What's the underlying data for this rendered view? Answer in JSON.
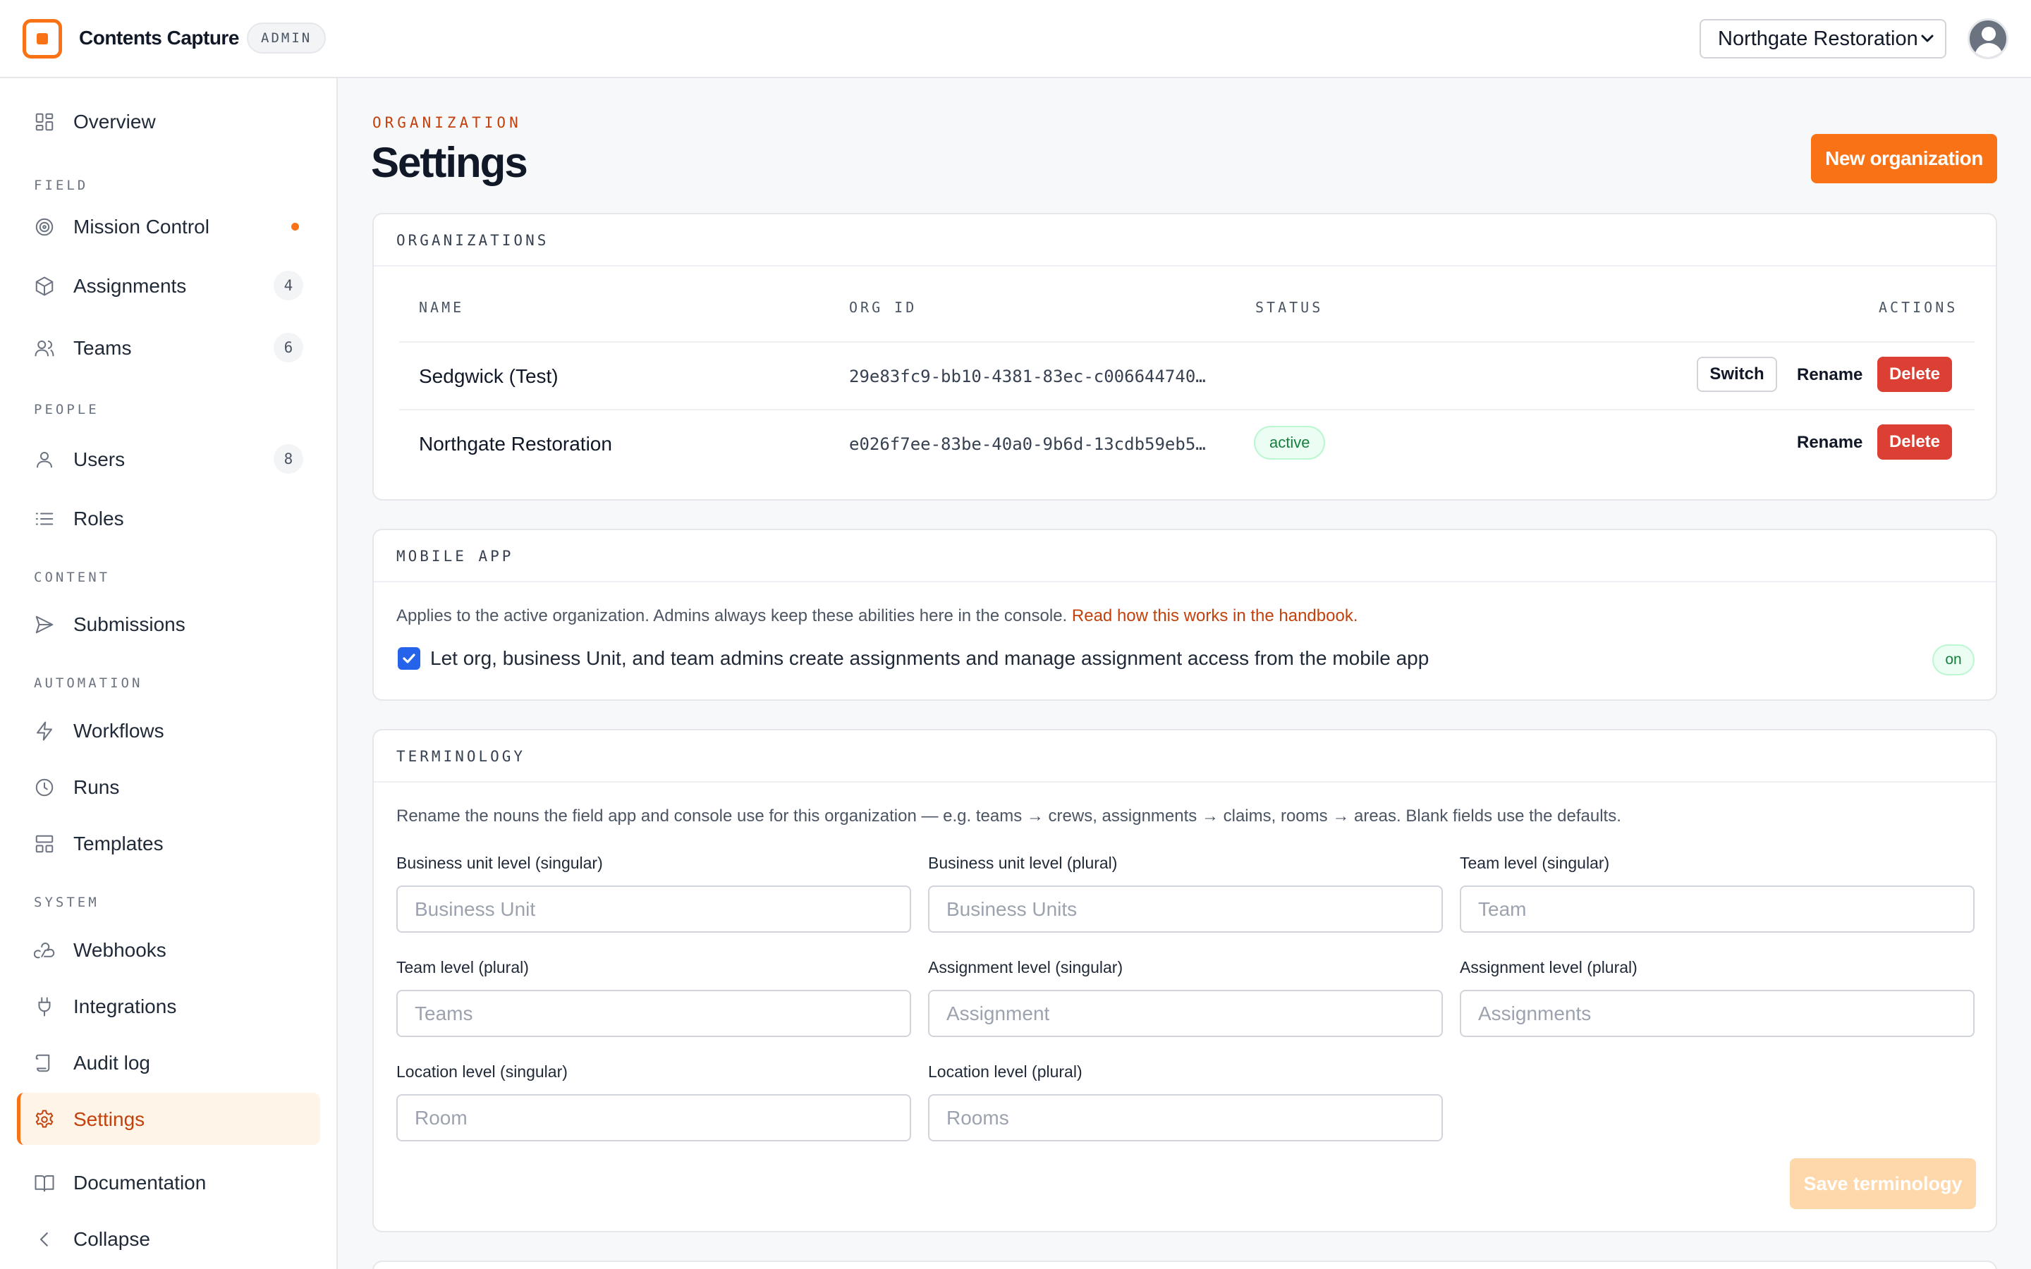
{
  "header": {
    "app_name": "Contents Capture",
    "role_badge": "ADMIN",
    "org_selector_value": "Northgate Restoration",
    "org_options": [
      "Northgate Restoration",
      "Sedgwick (Test)"
    ]
  },
  "sidebar": {
    "overview": "Overview",
    "sections": {
      "field": "FIELD",
      "people": "PEOPLE",
      "content": "CONTENT",
      "automation": "AUTOMATION",
      "system": "SYSTEM"
    },
    "items": {
      "mission_control": "Mission Control",
      "assignments": "Assignments",
      "assignments_count": "4",
      "teams": "Teams",
      "teams_count": "6",
      "users": "Users",
      "users_count": "8",
      "roles": "Roles",
      "submissions": "Submissions",
      "workflows": "Workflows",
      "runs": "Runs",
      "templates": "Templates",
      "webhooks": "Webhooks",
      "integrations": "Integrations",
      "audit_log": "Audit log",
      "settings": "Settings",
      "documentation": "Documentation",
      "collapse": "Collapse"
    }
  },
  "page": {
    "eyebrow": "ORGANIZATION",
    "title": "Settings",
    "new_org_button": "New organization"
  },
  "organizations": {
    "heading": "ORGANIZATIONS",
    "columns": {
      "name": "NAME",
      "org_id": "ORG ID",
      "status": "STATUS",
      "actions": "ACTIONS"
    },
    "rows": [
      {
        "name": "Sedgwick (Test)",
        "org_id": "29e83fc9-bb10-4381-83ec-c006644740…",
        "status": "",
        "switch": "Switch",
        "rename": "Rename",
        "delete": "Delete"
      },
      {
        "name": "Northgate Restoration",
        "org_id": "e026f7ee-83be-40a0-9b6d-13cdb59eb5…",
        "status": "active",
        "rename": "Rename",
        "delete": "Delete"
      }
    ]
  },
  "mobile_app": {
    "heading": "MOBILE APP",
    "description": "Applies to the active organization. Admins always keep these abilities here in the console.",
    "link": "Read how this works in the handbook.",
    "checkbox_label": "Let org, business Unit, and team admins create assignments and manage assignment access from the mobile app",
    "checked": true,
    "state_badge": "on"
  },
  "terminology": {
    "heading": "TERMINOLOGY",
    "description": "Rename the nouns the field app and console use for this organization — e.g. teams → crews, assignments → claims, rooms → areas. Blank fields use the defaults.",
    "fields": [
      {
        "label": "Business unit level (singular)",
        "placeholder": "Business Unit",
        "value": ""
      },
      {
        "label": "Business unit level (plural)",
        "placeholder": "Business Units",
        "value": ""
      },
      {
        "label": "Team level (singular)",
        "placeholder": "Team",
        "value": ""
      },
      {
        "label": "Team level (plural)",
        "placeholder": "Teams",
        "value": ""
      },
      {
        "label": "Assignment level (singular)",
        "placeholder": "Assignment",
        "value": ""
      },
      {
        "label": "Assignment level (plural)",
        "placeholder": "Assignments",
        "value": ""
      },
      {
        "label": "Location level (singular)",
        "placeholder": "Room",
        "value": ""
      },
      {
        "label": "Location level (plural)",
        "placeholder": "Rooms",
        "value": ""
      }
    ],
    "save_button": "Save terminology"
  },
  "colors": {
    "accent": "#f97316",
    "accent_text": "#c2410c",
    "danger": "#dc3f33",
    "success": "#15803d",
    "checkbox": "#2563eb"
  },
  "icons": {
    "overview": "grid-icon",
    "mission_control": "target-icon",
    "assignments": "cube-icon",
    "teams": "users-icon",
    "users": "user-icon",
    "roles": "list-icon",
    "submissions": "send-icon",
    "workflows": "bolt-icon",
    "runs": "clock-icon",
    "templates": "layout-icon",
    "webhooks": "webhook-icon",
    "integrations": "plug-icon",
    "audit_log": "scroll-icon",
    "settings": "gear-icon",
    "documentation": "book-icon",
    "collapse": "chevron-left-icon"
  }
}
